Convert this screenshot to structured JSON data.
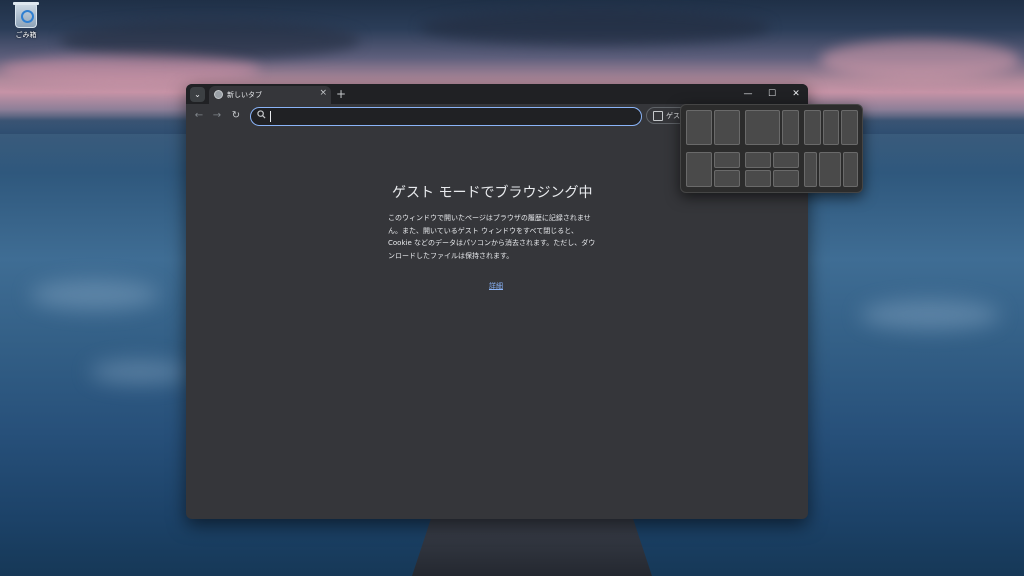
{
  "desktop": {
    "recycle_bin_label": "ごみ箱"
  },
  "browser": {
    "tab": {
      "title": "新しいタブ",
      "close": "×"
    },
    "new_tab": "+",
    "window_controls": {
      "minimize": "—",
      "maximize": "☐",
      "close": "✕"
    },
    "nav": {
      "back": "←",
      "forward": "→",
      "reload": "↻"
    },
    "omnibox": {
      "value": "",
      "icon": "search-icon"
    },
    "guest_chip": {
      "label": "ゲスト"
    },
    "page": {
      "title": "ゲスト モードでブラウジング中",
      "description": [
        "このウィンドウで開いたページはブラウザの履歴に記録されませ",
        "ん。また、開いているゲスト ウィンドウをすべて閉じると、",
        "Cookie などのデータはパソコンから消去されます。ただし、ダウ",
        "ンロードしたファイルは保持されます。"
      ],
      "details_link": "詳細"
    }
  },
  "snap_layouts": {
    "layouts": [
      "two-halves",
      "wide-narrow",
      "three-columns",
      "one-plus-two",
      "four-grid",
      "three-equal"
    ]
  },
  "colors": {
    "window_bg": "#35363a",
    "titlebar_bg": "#202124",
    "accent": "#8ab4f8",
    "text": "#e8eaed"
  }
}
